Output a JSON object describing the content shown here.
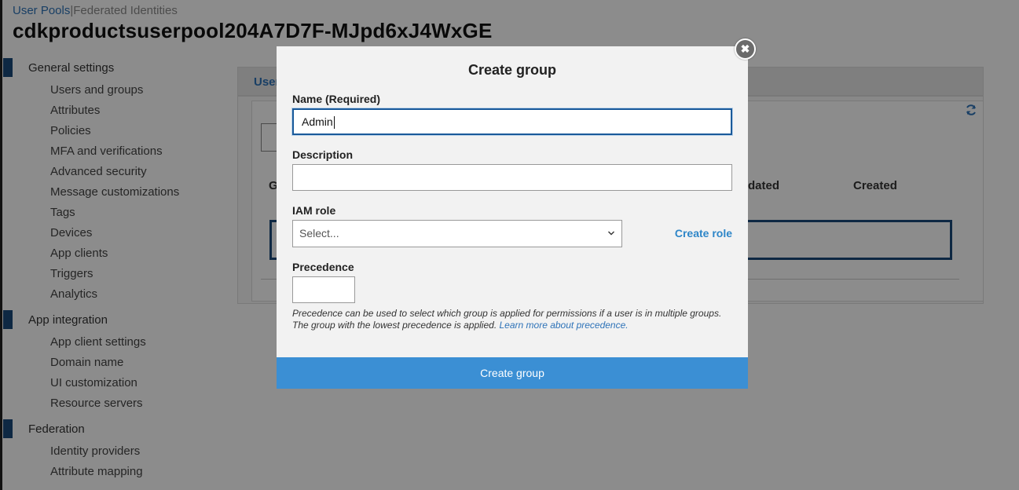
{
  "header": {
    "breadcrumb_active": "User Pools",
    "breadcrumb_separator": "|",
    "breadcrumb_other": "Federated Identities",
    "pool_name": "cdkproductsuserpool204A7D7F-MJpd6xJ4WxGE"
  },
  "sidebar": {
    "sections": [
      {
        "label": "General settings",
        "items": [
          "Users and groups",
          "Attributes",
          "Policies",
          "MFA and verifications",
          "Advanced security",
          "Message customizations",
          "Tags",
          "Devices",
          "App clients",
          "Triggers",
          "Analytics"
        ]
      },
      {
        "label": "App integration",
        "items": [
          "App client settings",
          "Domain name",
          "UI customization",
          "Resource servers"
        ]
      },
      {
        "label": "Federation",
        "items": [
          "Identity providers",
          "Attribute mapping"
        ]
      }
    ]
  },
  "panel": {
    "tab_label": "User",
    "col_group": "G",
    "col_updated": "dated",
    "col_created": "Created"
  },
  "modal": {
    "title": "Create group",
    "name_label": "Name (Required)",
    "name_value": "Admin",
    "description_label": "Description",
    "description_value": "",
    "iam_role_label": "IAM role",
    "iam_role_placeholder": "Select...",
    "create_role_link": "Create role",
    "precedence_label": "Precedence",
    "precedence_value": "",
    "help_text": "Precedence can be used to select which group is applied for permissions if a user is in multiple groups. The group with the lowest precedence is applied.",
    "learn_more_link": "Learn more about precedence.",
    "submit_label": "Create group",
    "close_glyph": "✖"
  },
  "colors": {
    "accent": "#3b8fd4",
    "link": "#2e73b8",
    "nav_bar": "#1a4a7a"
  }
}
